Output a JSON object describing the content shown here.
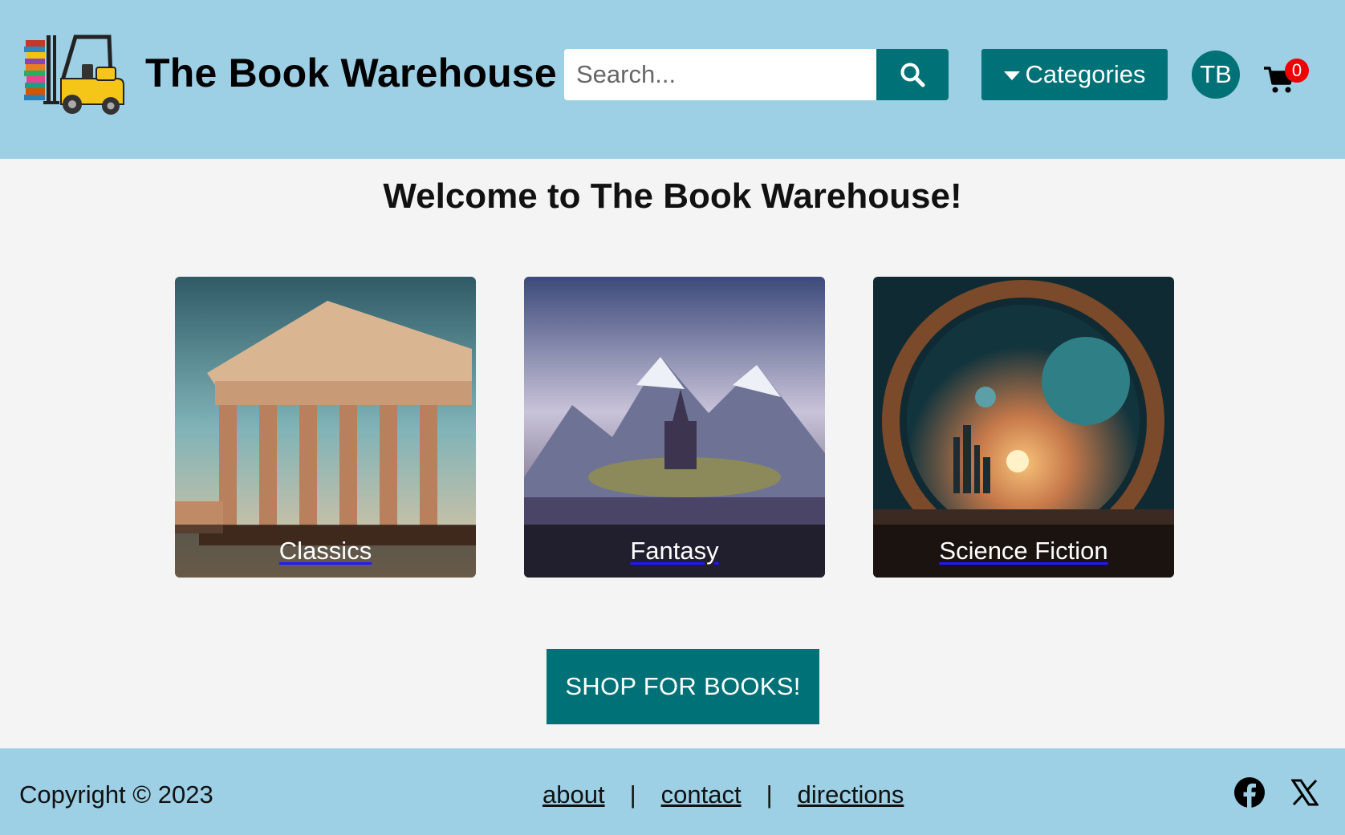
{
  "header": {
    "brand": "The Book Warehouse",
    "search_placeholder": "Search...",
    "categories_label": "Categories",
    "avatar_initials": "TB",
    "cart_count": "0"
  },
  "main": {
    "welcome": "Welcome to The Book Warehouse!",
    "cards": [
      {
        "label": "Classics"
      },
      {
        "label": "Fantasy"
      },
      {
        "label": "Science Fiction"
      }
    ],
    "shop_button": "SHOP FOR BOOKS!"
  },
  "footer": {
    "copyright": "Copyright © 2023",
    "links": [
      "about",
      "contact",
      "directions"
    ],
    "separator": "|"
  },
  "colors": {
    "header_bg": "#9dcfe5",
    "accent": "#007176",
    "badge": "#ee0000"
  },
  "icons": [
    "forklift-logo-icon",
    "search-icon",
    "caret-down-icon",
    "cart-icon",
    "facebook-icon",
    "x-logo-icon"
  ]
}
